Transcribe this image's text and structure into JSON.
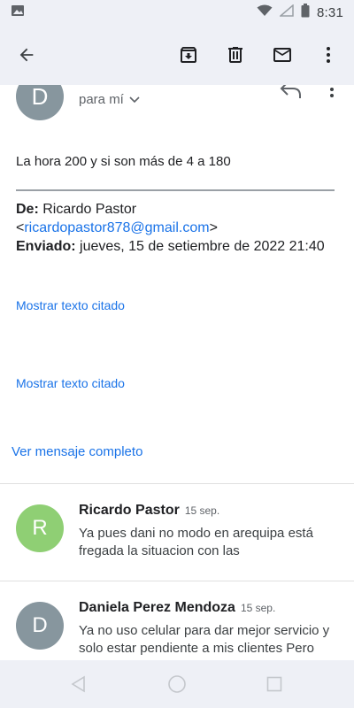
{
  "status_bar": {
    "time": "8:31",
    "icons": [
      "image-icon",
      "wifi-icon",
      "signal-icon",
      "battery-icon"
    ]
  },
  "toolbar": {
    "icons": [
      "back-arrow-icon",
      "archive-icon",
      "delete-icon",
      "mail-icon",
      "more-vert-icon"
    ]
  },
  "message": {
    "sender_initial": "D",
    "recipient_label": "para mí",
    "body": "La hora 200 y si son más de 4 a 180",
    "quoted": {
      "from_label": "De:",
      "from_name": "Ricardo Pastor",
      "from_email": "ricardopastor878@gmail.com",
      "sent_label": "Enviado:",
      "sent_value": "jueves, 15 de setiembre de 2022 21:40"
    },
    "show_quoted_1": "Mostrar texto citado",
    "show_quoted_2": "Mostrar texto citado",
    "view_full": "Ver mensaje completo"
  },
  "thread": [
    {
      "initial": "R",
      "avatar_color": "#8fcf74",
      "name": "Ricardo Pastor",
      "date": "15 sep.",
      "snippet": "Ya pues dani no modo en arequipa está fregada la situacion con las"
    },
    {
      "initial": "D",
      "avatar_color": "#87969e",
      "name": "Daniela Perez Mendoza",
      "date": "15 sep.",
      "snippet": "Ya no uso celular para dar mejor servicio y solo estar pendiente a mis clientes Pero"
    }
  ],
  "nav_bar": {
    "icons": [
      "nav-back-icon",
      "nav-home-icon",
      "nav-recents-icon"
    ]
  },
  "colors": {
    "accent_link": "#1a73e8",
    "bar_background": "#eef0f6"
  }
}
